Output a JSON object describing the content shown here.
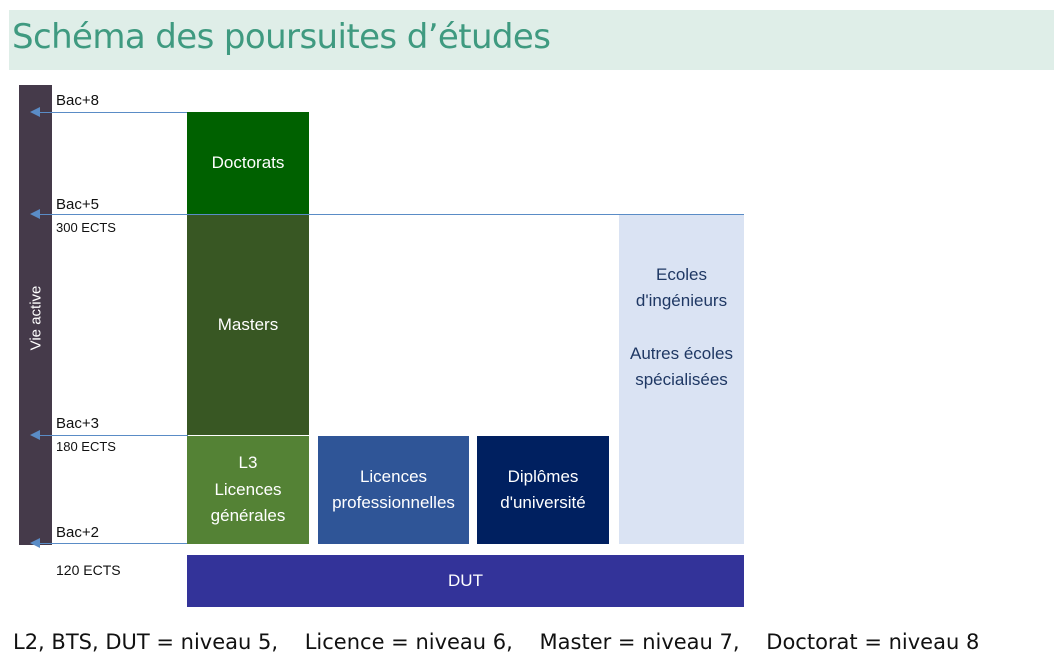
{
  "title": "Schéma des poursuites d’études",
  "vie_active": "Vie active",
  "levels": [
    {
      "id": "bac8",
      "label": "Bac+8",
      "ects": ""
    },
    {
      "id": "bac5",
      "label": "Bac+5",
      "ects": "300 ECTS"
    },
    {
      "id": "bac3",
      "label": "Bac+3",
      "ects": "180 ECTS"
    },
    {
      "id": "bac2",
      "label": "Bac+2",
      "ects": "120 ECTS"
    }
  ],
  "boxes": {
    "doctorats": {
      "text": "Doctorats",
      "color": "#006100"
    },
    "masters": {
      "text": "Masters",
      "color": "#385723"
    },
    "l3": {
      "text": "L3\nLicences\ngénérales",
      "color": "#548235"
    },
    "licences_pro": {
      "text": "Licences\nprofessionnelles",
      "color": "#2f5597"
    },
    "diplomes_univ": {
      "text": "Diplômes\nd'université",
      "color": "#002060"
    },
    "ecoles": {
      "text": "Ecoles\nd'ingénieurs\n\nAutres écoles\nspécialisées",
      "color": "#dae3f3",
      "text_color": "#1f3864"
    },
    "dut": {
      "text": "DUT",
      "color": "#333399"
    }
  },
  "colors": {
    "title": "#3f9a80",
    "title_band": "#dfeee8",
    "vie_active_bar": "#453a4a",
    "arrow": "#5a8cc6"
  },
  "footer": "L2, BTS, DUT = niveau 5,    Licence = niveau 6,    Master = niveau 7,    Doctorat = niveau 8"
}
